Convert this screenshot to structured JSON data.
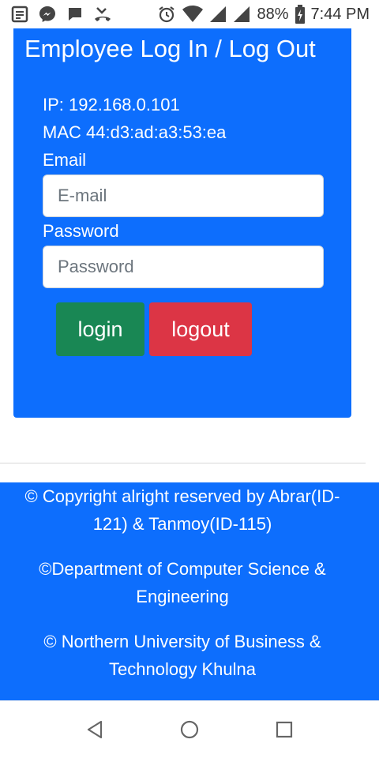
{
  "status_bar": {
    "battery": "88%",
    "time": "7:44 PM",
    "left_icons": [
      "notes-icon",
      "messenger-icon",
      "chat-icon",
      "missed-call-icon"
    ],
    "right_icons": [
      "alarm-icon",
      "wifi-icon",
      "signal-icon",
      "signal-icon",
      "battery-charging-icon"
    ]
  },
  "card": {
    "title": "Employee Log In / Log Out",
    "ip": "IP: 192.168.0.101",
    "mac": "MAC 44:d3:ad:a3:53:ea",
    "email_label": "Email",
    "email_placeholder": "E-mail",
    "email_value": "",
    "password_label": "Password",
    "password_placeholder": "Password",
    "password_value": "",
    "login_label": "login",
    "logout_label": "logout"
  },
  "footer": {
    "line1": "© Copyright alright reserved by Abrar(ID-121) & Tanmoy(ID-115)",
    "line2": "©Department of Computer Science & Engineering",
    "line3": "© Northern University of Business & Technology Khulna"
  },
  "nav_bar": {
    "icons": [
      "back-icon",
      "home-icon",
      "recents-icon"
    ]
  },
  "colors": {
    "primary": "#0d6efd",
    "success": "#198754",
    "danger": "#dc3545"
  }
}
